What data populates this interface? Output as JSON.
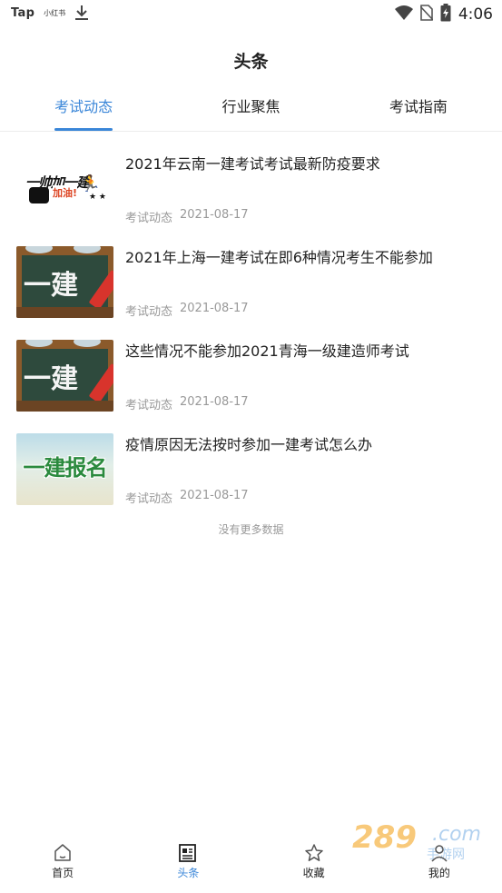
{
  "status_bar": {
    "left_app": "Tap",
    "left_small": "小红书",
    "time": "4:06",
    "icons": [
      "download-icon",
      "wifi-icon",
      "no-sim-icon",
      "battery-charging-icon"
    ]
  },
  "header": {
    "title": "头条"
  },
  "tabs": [
    {
      "label": "考试动态",
      "active": true
    },
    {
      "label": "行业聚焦",
      "active": false
    },
    {
      "label": "考试指南",
      "active": false
    }
  ],
  "articles": [
    {
      "title": "2021年云南一建考试考试最新防疫要求",
      "category": "考试动态",
      "date": "2021-08-17",
      "thumb_text": "一帅加一建",
      "thumb_sub": "加油!"
    },
    {
      "title": "2021年上海一建考试在即6种情况考生不能参加",
      "category": "考试动态",
      "date": "2021-08-17",
      "thumb_text": "一建"
    },
    {
      "title": "这些情况不能参加2021青海一级建造师考试",
      "category": "考试动态",
      "date": "2021-08-17",
      "thumb_text": "一建"
    },
    {
      "title": "疫情原因无法按时参加一建考试怎么办",
      "category": "考试动态",
      "date": "2021-08-17",
      "thumb_text": "一建报名"
    }
  ],
  "list_footer": "没有更多数据",
  "bottom_nav": [
    {
      "label": "首页",
      "icon": "home-icon",
      "active": false
    },
    {
      "label": "头条",
      "icon": "news-icon",
      "active": true
    },
    {
      "label": "收藏",
      "icon": "star-icon",
      "active": false
    },
    {
      "label": "我的",
      "icon": "user-icon",
      "active": false
    }
  ],
  "watermark": {
    "num": "289",
    "com": ".com",
    "sub": "手游网"
  },
  "colors": {
    "accent": "#3a86d8",
    "meta": "#999999",
    "text": "#222222"
  }
}
